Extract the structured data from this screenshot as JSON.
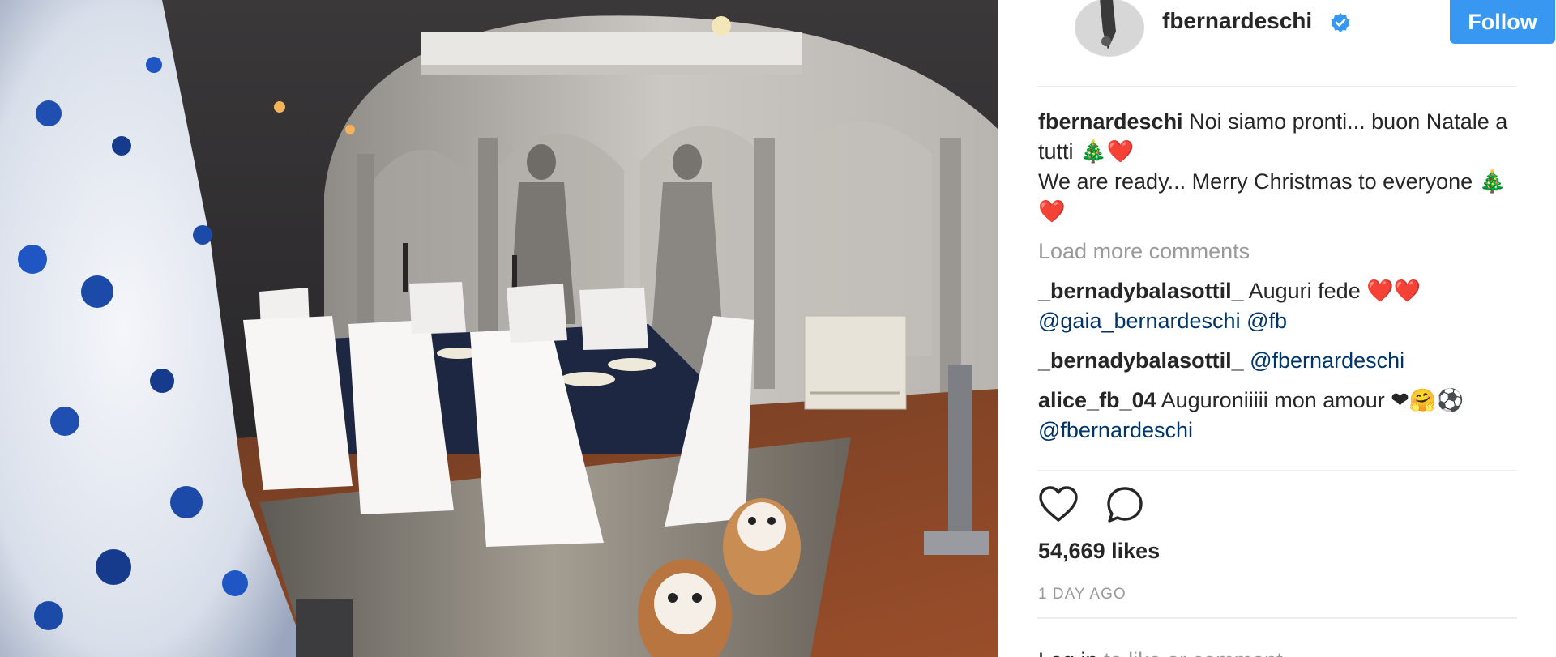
{
  "post": {
    "username": "fbernardeschi",
    "verified": true,
    "follow_label": "Follow",
    "photo_description_icon": "christmas-dining-room-photo"
  },
  "caption": {
    "author": "fbernardeschi",
    "text": "Noi siamo pronti... buon Natale a tutti 🎄❤️",
    "text2": "We are ready... Merry Christmas to everyone 🎄❤️"
  },
  "load_more_label": "Load more comments",
  "comments": [
    {
      "author": "_bernadybalasottil_",
      "text": "Auguri fede ❤️❤️",
      "mention1": "@gaia_bernardeschi",
      "mention2": "@fb"
    },
    {
      "author": "_bernadybalasottil_",
      "mention1": "@fbernardeschi"
    },
    {
      "author": "alice_fb_04",
      "text": "Auguroniiiii mon amour ❤🤗⚽",
      "mention1": "@fbernardeschi"
    }
  ],
  "actions": {
    "like_icon": "heart-icon",
    "comment_icon": "comment-bubble-icon"
  },
  "likes_label": "54,669 likes",
  "time_label": "1 DAY AGO",
  "login": {
    "link": "Log in",
    "rest": " to like or comment."
  },
  "colors": {
    "follow_bg": "#3897f0",
    "mention": "#003569",
    "muted": "#999999",
    "text": "#262626"
  }
}
